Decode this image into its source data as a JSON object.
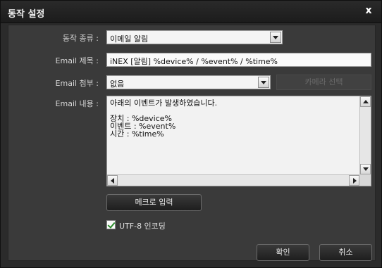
{
  "dialog": {
    "title": "동작 설정",
    "close_glyph": "x"
  },
  "form": {
    "action_type": {
      "label": "동작 종류 :",
      "value": "이메일 알림"
    },
    "email_subject": {
      "label": "Email 제목 :",
      "value": "iNEX [알림] %device% / %event% / %time%"
    },
    "email_attach": {
      "label": "Email 첨부 :",
      "value": "없음",
      "camera_button": "카메라 선택"
    },
    "email_body": {
      "label": "Email 내용 :",
      "value": "아래의 이벤트가 발생하였습니다.\n\n장치 : %device%\n이벤트 : %event%\n시간 : %time%"
    },
    "macro_button": "메크로 입력",
    "utf8": {
      "label": "UTF-8 인코딩",
      "checked": true
    }
  },
  "buttons": {
    "ok": "확인",
    "cancel": "취소"
  },
  "icons": {
    "close": "close-icon",
    "dropdown": "chevron-down-icon",
    "check": "checkmark-icon"
  }
}
